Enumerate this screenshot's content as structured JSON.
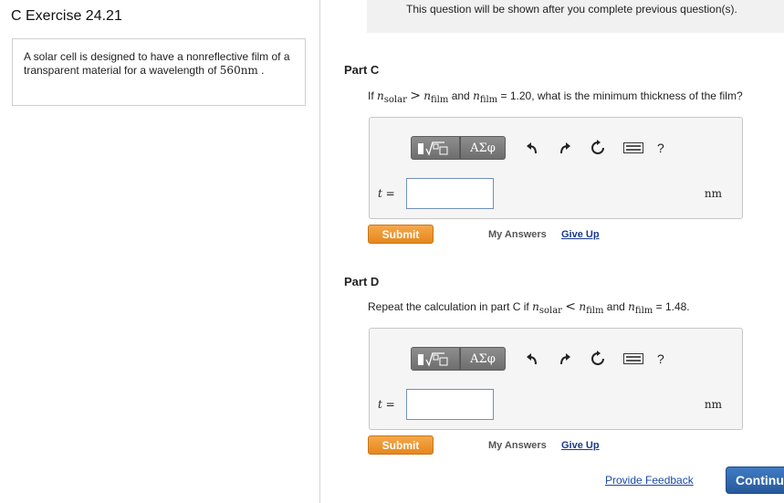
{
  "page": {
    "title": "C Exercise 24.21",
    "locked_notice": "This question will be shown after you complete previous question(s)."
  },
  "problem": {
    "text": "A solar cell is designed to have a nonreflective film of a transparent material for a wavelength of",
    "value": "560nm",
    "end": "."
  },
  "parts": [
    {
      "title": "Part C",
      "q_prefix": "If",
      "n_solar": "n",
      "sub_solar": "solar",
      "relation": ">",
      "n_film": "n",
      "sub_film": "film",
      "and": "and",
      "n_film2": "n",
      "sub_film2": "film",
      "q_suffix": "= 1.20, what is the minimum thickness of the film?",
      "var_label": "t =",
      "unit": "nm",
      "answer": "",
      "submit": "Submit",
      "my_answers": "My Answers",
      "give_up": "Give Up"
    },
    {
      "title": "Part D",
      "q_prefix": "Repeat the calculation in part C if",
      "n_solar": "n",
      "sub_solar": "solar",
      "relation": "<",
      "n_film": "n",
      "sub_film": "film",
      "and": "and",
      "n_film2": "n",
      "sub_film2": "film",
      "q_suffix": "= 1.48.",
      "var_label": "t =",
      "unit": "nm",
      "answer": "",
      "submit": "Submit",
      "my_answers": "My Answers",
      "give_up": "Give Up"
    }
  ],
  "toolbar": {
    "greek_label": "ΑΣφ",
    "help_label": "?",
    "icons": [
      "templates-icon",
      "greek-symbols-icon",
      "undo-icon",
      "redo-icon",
      "reset-icon",
      "keyboard-icon",
      "help-icon"
    ]
  },
  "footer": {
    "feedback": "Provide Feedback",
    "continue": "Continue"
  }
}
